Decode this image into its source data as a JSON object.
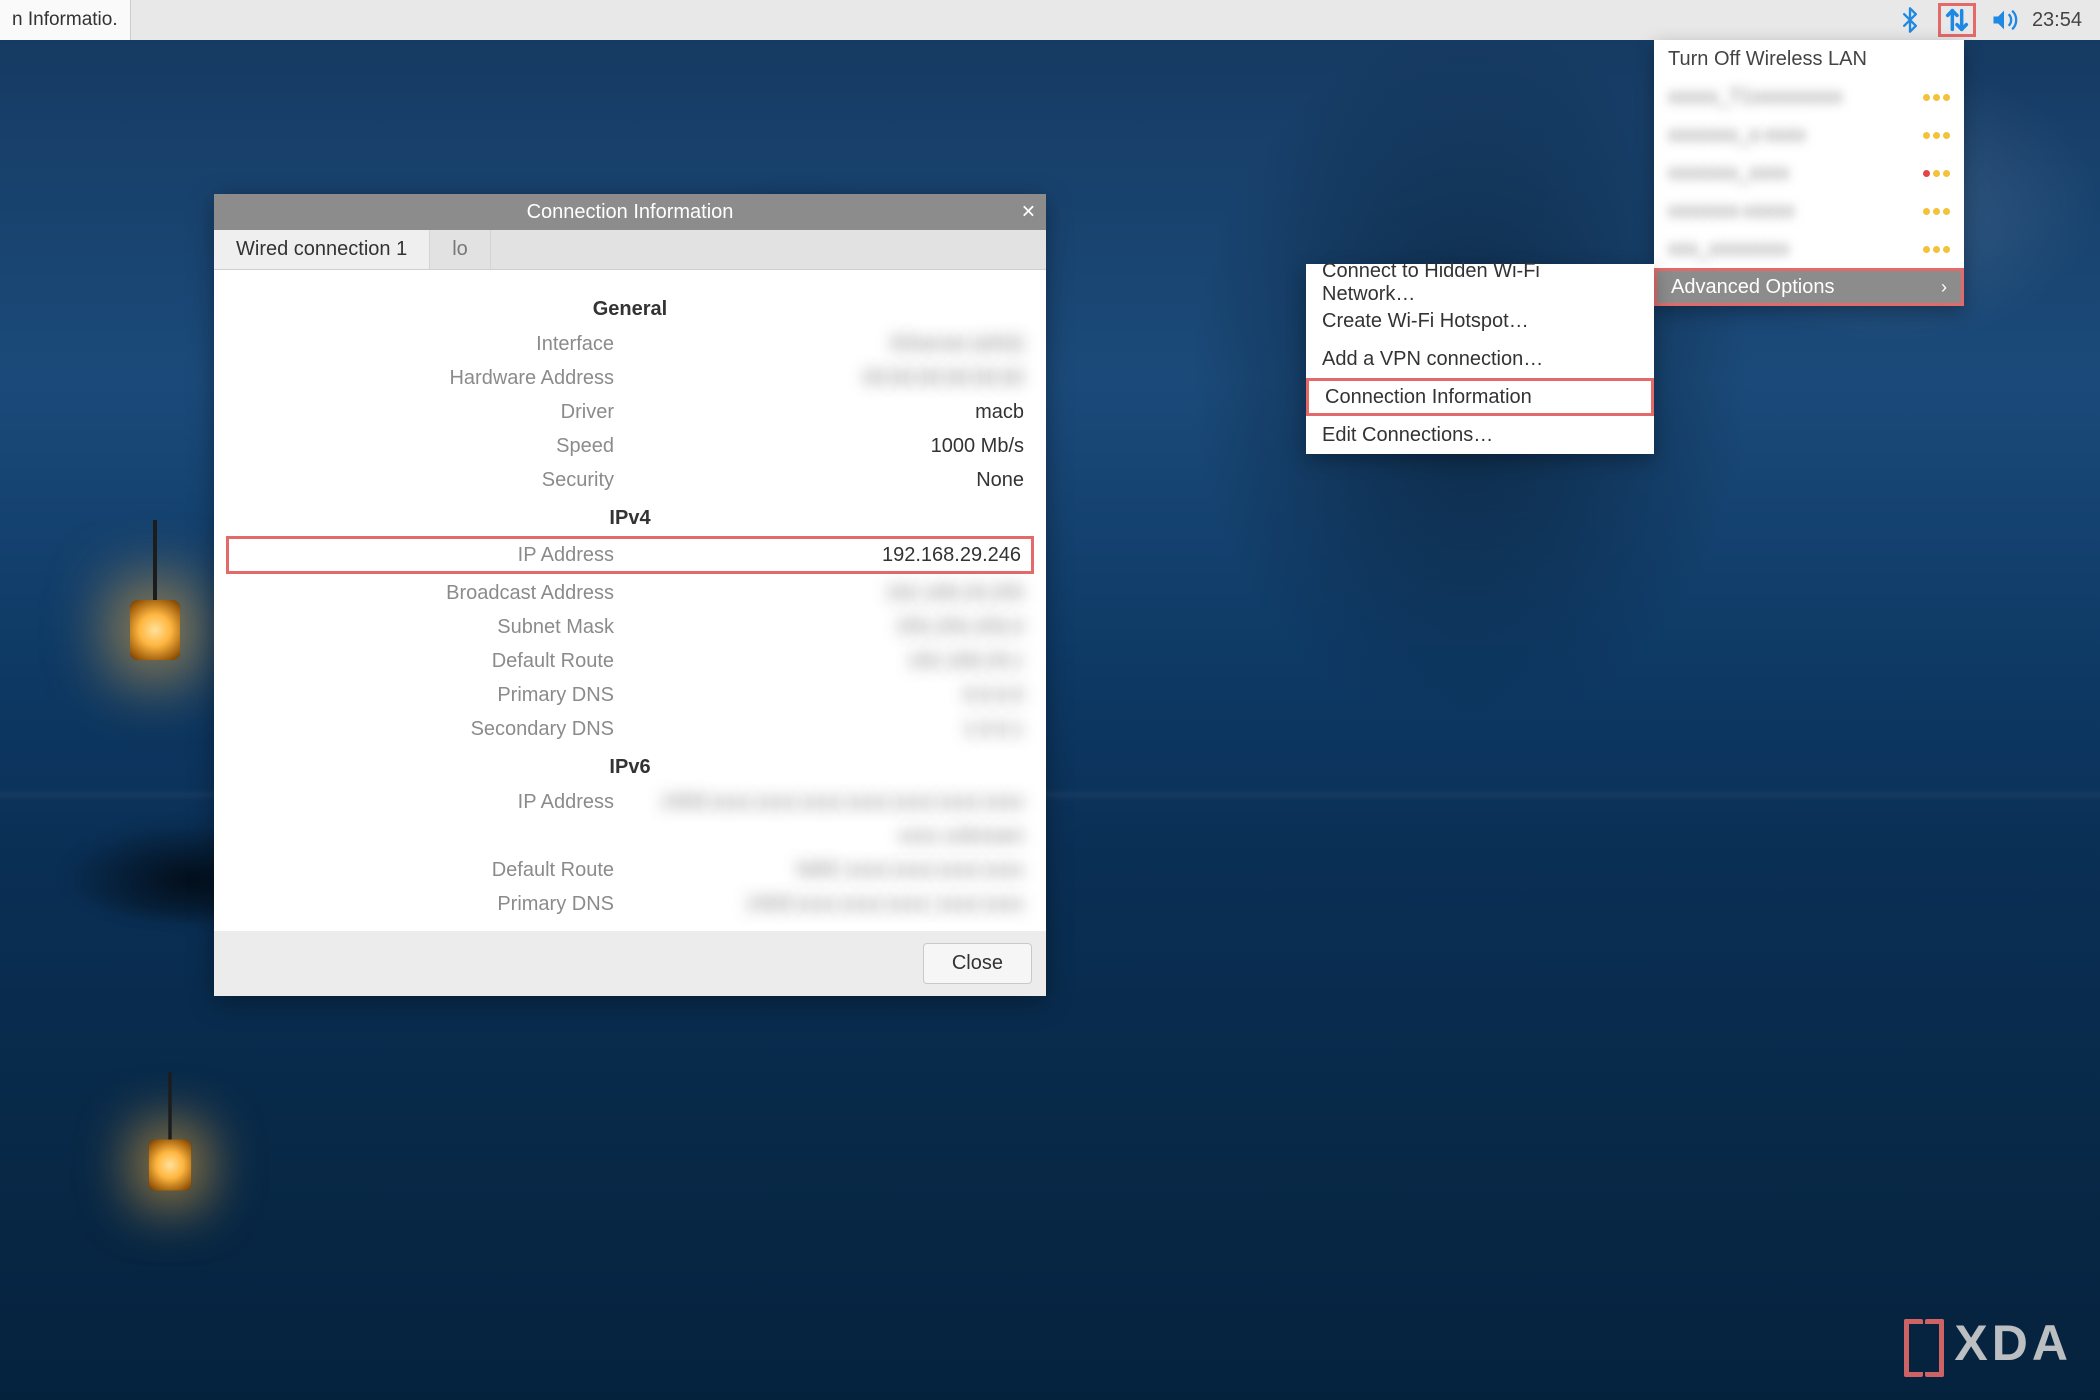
{
  "panel": {
    "task_button": "n Informatio.",
    "clock": "23:54"
  },
  "netmenu": {
    "turn_off": "Turn Off Wireless LAN",
    "wifi": [
      {
        "ssid": "xxxxx_T1xxxxxxxxx",
        "secure": false
      },
      {
        "ssid": "xxxxxxx_x-xxxx",
        "secure": false
      },
      {
        "ssid": "xxxxxxx_xxxx",
        "secure": true
      },
      {
        "ssid": "xxxxxxx-xxxxx",
        "secure": false
      },
      {
        "ssid": "xxx_xxxxxxxx",
        "secure": false
      }
    ],
    "advanced": "Advanced Options"
  },
  "submenu": {
    "items": [
      "Connect to Hidden Wi-Fi Network…",
      "Create Wi-Fi Hotspot…",
      "Add a VPN connection…",
      "Connection Information",
      "Edit Connections…"
    ],
    "highlight_index": 3
  },
  "dialog": {
    "title": "Connection Information",
    "tabs": [
      "Wired connection 1",
      "lo"
    ],
    "active_tab": 0,
    "close_button": "Close",
    "sections": {
      "general": {
        "title": "General",
        "rows": [
          {
            "label": "Interface",
            "value": "Ethernet (eth0)",
            "blurred": true
          },
          {
            "label": "Hardware Address",
            "value": "00:00:00:00:00:00",
            "blurred": true
          },
          {
            "label": "Driver",
            "value": "macb",
            "blurred": false
          },
          {
            "label": "Speed",
            "value": "1000 Mb/s",
            "blurred": false
          },
          {
            "label": "Security",
            "value": "None",
            "blurred": false
          }
        ]
      },
      "ipv4": {
        "title": "IPv4",
        "rows": [
          {
            "label": "IP Address",
            "value": "192.168.29.246",
            "blurred": false,
            "highlight": true
          },
          {
            "label": "Broadcast Address",
            "value": "192.168.29.255",
            "blurred": true
          },
          {
            "label": "Subnet Mask",
            "value": "255.255.255.0",
            "blurred": true
          },
          {
            "label": "Default Route",
            "value": "192.168.29.1",
            "blurred": true
          },
          {
            "label": "Primary DNS",
            "value": "0.0.0.0",
            "blurred": true
          },
          {
            "label": "Secondary DNS",
            "value": "1.0.0.1",
            "blurred": true
          }
        ]
      },
      "ipv6": {
        "title": "IPv6",
        "rows": [
          {
            "label": "IP Address",
            "value": "2400:xxxx:xxxx:xxxx:xxxx:xxxx:xxxx:xxxx",
            "blurred": true
          },
          {
            "label": "",
            "value": "xxxx unknown",
            "blurred": true
          },
          {
            "label": "Default Route",
            "value": "fe80::xxxx:xxxx:xxxx:xxxx",
            "blurred": true
          },
          {
            "label": "Primary DNS",
            "value": "2400:xxxx:xxxx:xxxx::xxxx:xxxx",
            "blurred": true
          }
        ]
      }
    }
  },
  "watermark": "XDA"
}
